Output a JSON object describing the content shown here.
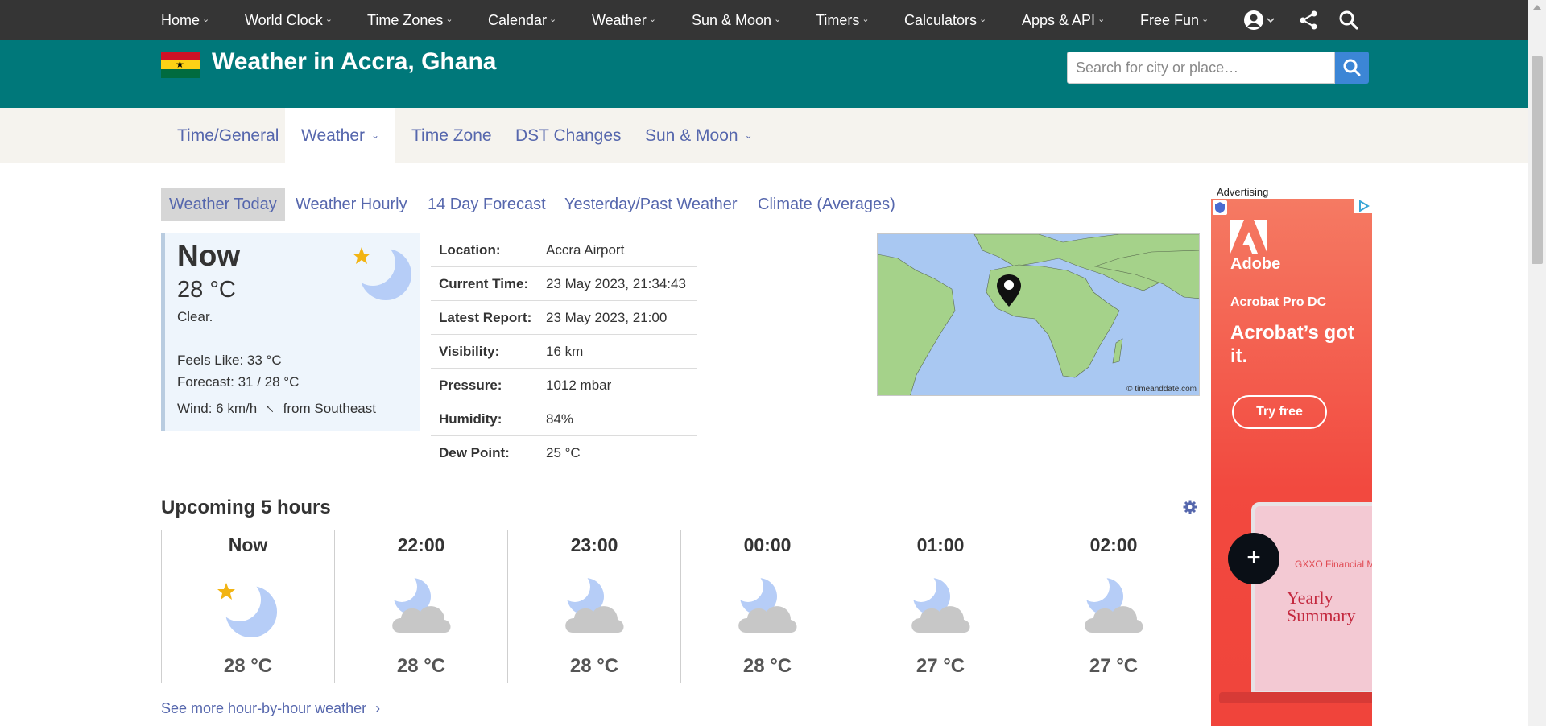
{
  "topnav": {
    "items": [
      {
        "label": "Home"
      },
      {
        "label": "World Clock"
      },
      {
        "label": "Time Zones"
      },
      {
        "label": "Calendar"
      },
      {
        "label": "Weather"
      },
      {
        "label": "Sun & Moon"
      },
      {
        "label": "Timers"
      },
      {
        "label": "Calculators"
      },
      {
        "label": "Apps & API"
      },
      {
        "label": "Free Fun"
      }
    ],
    "icons": [
      "account-icon",
      "share-icon",
      "search-icon"
    ]
  },
  "header": {
    "title": "Weather in Accra, Ghana",
    "search_placeholder": "Search for city or place…",
    "flag_colors": [
      "#ce1126",
      "#fcd116",
      "#006b3f"
    ]
  },
  "subnav": {
    "tabs": [
      {
        "label": "Time/General"
      },
      {
        "label": "Weather",
        "active": true
      },
      {
        "label": "Time Zone"
      },
      {
        "label": "DST Changes"
      },
      {
        "label": "Sun & Moon"
      }
    ]
  },
  "pill_tabs": [
    {
      "label": "Weather Today",
      "active": true
    },
    {
      "label": "Weather Hourly"
    },
    {
      "label": "14 Day Forecast"
    },
    {
      "label": "Yesterday/Past Weather"
    },
    {
      "label": "Climate (Averages)"
    }
  ],
  "now": {
    "label": "Now",
    "temp": "28 °C",
    "condition": "Clear.",
    "feels_like": "Feels Like: 33 °C",
    "forecast": "Forecast: 31 / 28 °C",
    "wind_speed": "Wind: 6 km/h",
    "wind_dir": "from Southeast"
  },
  "details": [
    {
      "key": "Location:",
      "value": "Accra Airport"
    },
    {
      "key": "Current Time:",
      "value": "23 May 2023, 21:34:43"
    },
    {
      "key": "Latest Report:",
      "value": "23 May 2023, 21:00"
    },
    {
      "key": "Visibility:",
      "value": "16 km"
    },
    {
      "key": "Pressure:",
      "value": "1012 mbar"
    },
    {
      "key": "Humidity:",
      "value": "84%"
    },
    {
      "key": "Dew Point:",
      "value": "25 °C"
    }
  ],
  "map": {
    "copyright": "© timeanddate.com"
  },
  "upcoming": {
    "title": "Upcoming 5 hours",
    "hours": [
      {
        "label": "Now",
        "temp": "28 °C",
        "icon": "clear-night-icon"
      },
      {
        "label": "22:00",
        "temp": "28 °C",
        "icon": "partly-cloudy-night-icon"
      },
      {
        "label": "23:00",
        "temp": "28 °C",
        "icon": "partly-cloudy-night-icon"
      },
      {
        "label": "00:00",
        "temp": "28 °C",
        "icon": "partly-cloudy-night-icon"
      },
      {
        "label": "01:00",
        "temp": "27 °C",
        "icon": "partly-cloudy-night-icon"
      },
      {
        "label": "02:00",
        "temp": "27 °C",
        "icon": "partly-cloudy-night-icon"
      }
    ],
    "more_link": "See more hour-by-hour weather"
  },
  "ad": {
    "label": "Advertising",
    "brand": "Adobe",
    "product": "Acrobat Pro DC",
    "headline": "Acrobat’s got it.",
    "cta": "Try free",
    "company": "GXXO Financial Management",
    "doc_title": "Yearly Summary"
  },
  "fab": {
    "label": "+"
  }
}
